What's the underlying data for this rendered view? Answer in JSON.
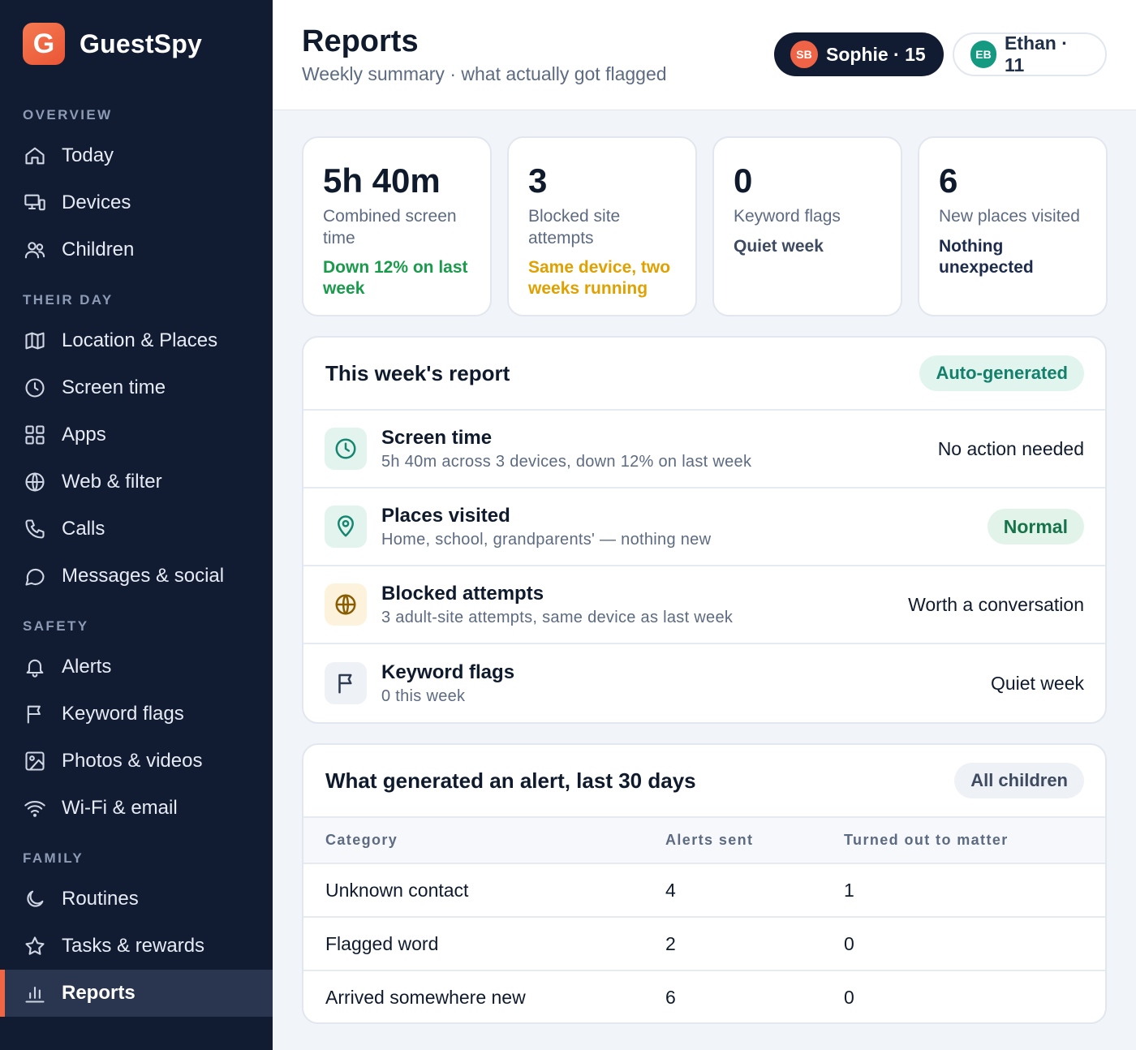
{
  "brand": {
    "logo_letter": "G",
    "name": "GuestSpy"
  },
  "sidebar": {
    "sections": [
      {
        "title": "OVERVIEW",
        "items": [
          {
            "label": "Today",
            "icon": "home-icon"
          },
          {
            "label": "Devices",
            "icon": "devices-icon"
          },
          {
            "label": "Children",
            "icon": "users-icon"
          }
        ]
      },
      {
        "title": "THEIR DAY",
        "items": [
          {
            "label": "Location & Places",
            "icon": "map-icon"
          },
          {
            "label": "Screen time",
            "icon": "clock-icon"
          },
          {
            "label": "Apps",
            "icon": "grid-icon"
          },
          {
            "label": "Web & filter",
            "icon": "globe-icon"
          },
          {
            "label": "Calls",
            "icon": "phone-icon"
          },
          {
            "label": "Messages & social",
            "icon": "chat-icon"
          }
        ]
      },
      {
        "title": "SAFETY",
        "items": [
          {
            "label": "Alerts",
            "icon": "bell-icon"
          },
          {
            "label": "Keyword flags",
            "icon": "flag-icon"
          },
          {
            "label": "Photos & videos",
            "icon": "image-icon"
          },
          {
            "label": "Wi-Fi & email",
            "icon": "wifi-icon"
          }
        ]
      },
      {
        "title": "FAMILY",
        "items": [
          {
            "label": "Routines",
            "icon": "moon-icon"
          },
          {
            "label": "Tasks & rewards",
            "icon": "star-icon"
          },
          {
            "label": "Reports",
            "icon": "bar-chart-icon",
            "active": true
          }
        ]
      }
    ]
  },
  "header": {
    "title": "Reports",
    "subtitle": "Weekly summary · what actually got flagged",
    "children": [
      {
        "initials": "SB",
        "label": "Sophie · 15",
        "selected": true
      },
      {
        "initials": "EB",
        "label": "Ethan · 11",
        "selected": false
      }
    ]
  },
  "stats": [
    {
      "value": "5h 40m",
      "label": "Combined screen time",
      "note": "Down 12% on last week",
      "note_color": "#1a9a4b"
    },
    {
      "value": "3",
      "label": "Blocked site attempts",
      "note": "Same device, two weeks running",
      "note_color": "#e0a100"
    },
    {
      "value": "0",
      "label": "Keyword flags",
      "note": "Quiet week",
      "note_color": "#3d4a60"
    },
    {
      "value": "6",
      "label": "New places visited",
      "note": "Nothing unexpected",
      "note_color": "#1d2c4c"
    }
  ],
  "weekly_report": {
    "title": "This week's report",
    "badge": "Auto-generated",
    "rows": [
      {
        "icon": "clock-icon",
        "title": "Screen time",
        "detail": "5h 40m across 3 devices, down 12% on last week",
        "status": "No action needed",
        "status_pill": false
      },
      {
        "icon": "map-pin-icon",
        "title": "Places visited",
        "detail": "Home, school, grandparents' — nothing new",
        "status": "Normal",
        "status_pill": true
      },
      {
        "icon": "globe-icon",
        "title": "Blocked attempts",
        "detail": "3 adult-site attempts, same device as last week",
        "status": "Worth a conversation",
        "status_pill": false
      },
      {
        "icon": "flag-icon",
        "title": "Keyword flags",
        "detail": "0 this week",
        "status": "Quiet week",
        "status_pill": false
      }
    ]
  },
  "alerts_table": {
    "title": "What generated an alert, last 30 days",
    "filter": "All children",
    "columns": [
      "Category",
      "Alerts sent",
      "Turned out to matter"
    ],
    "rows": [
      [
        "Unknown contact",
        "4",
        "1"
      ],
      [
        "Flagged word",
        "2",
        "0"
      ],
      [
        "Arrived somewhere new",
        "6",
        "0"
      ]
    ]
  }
}
